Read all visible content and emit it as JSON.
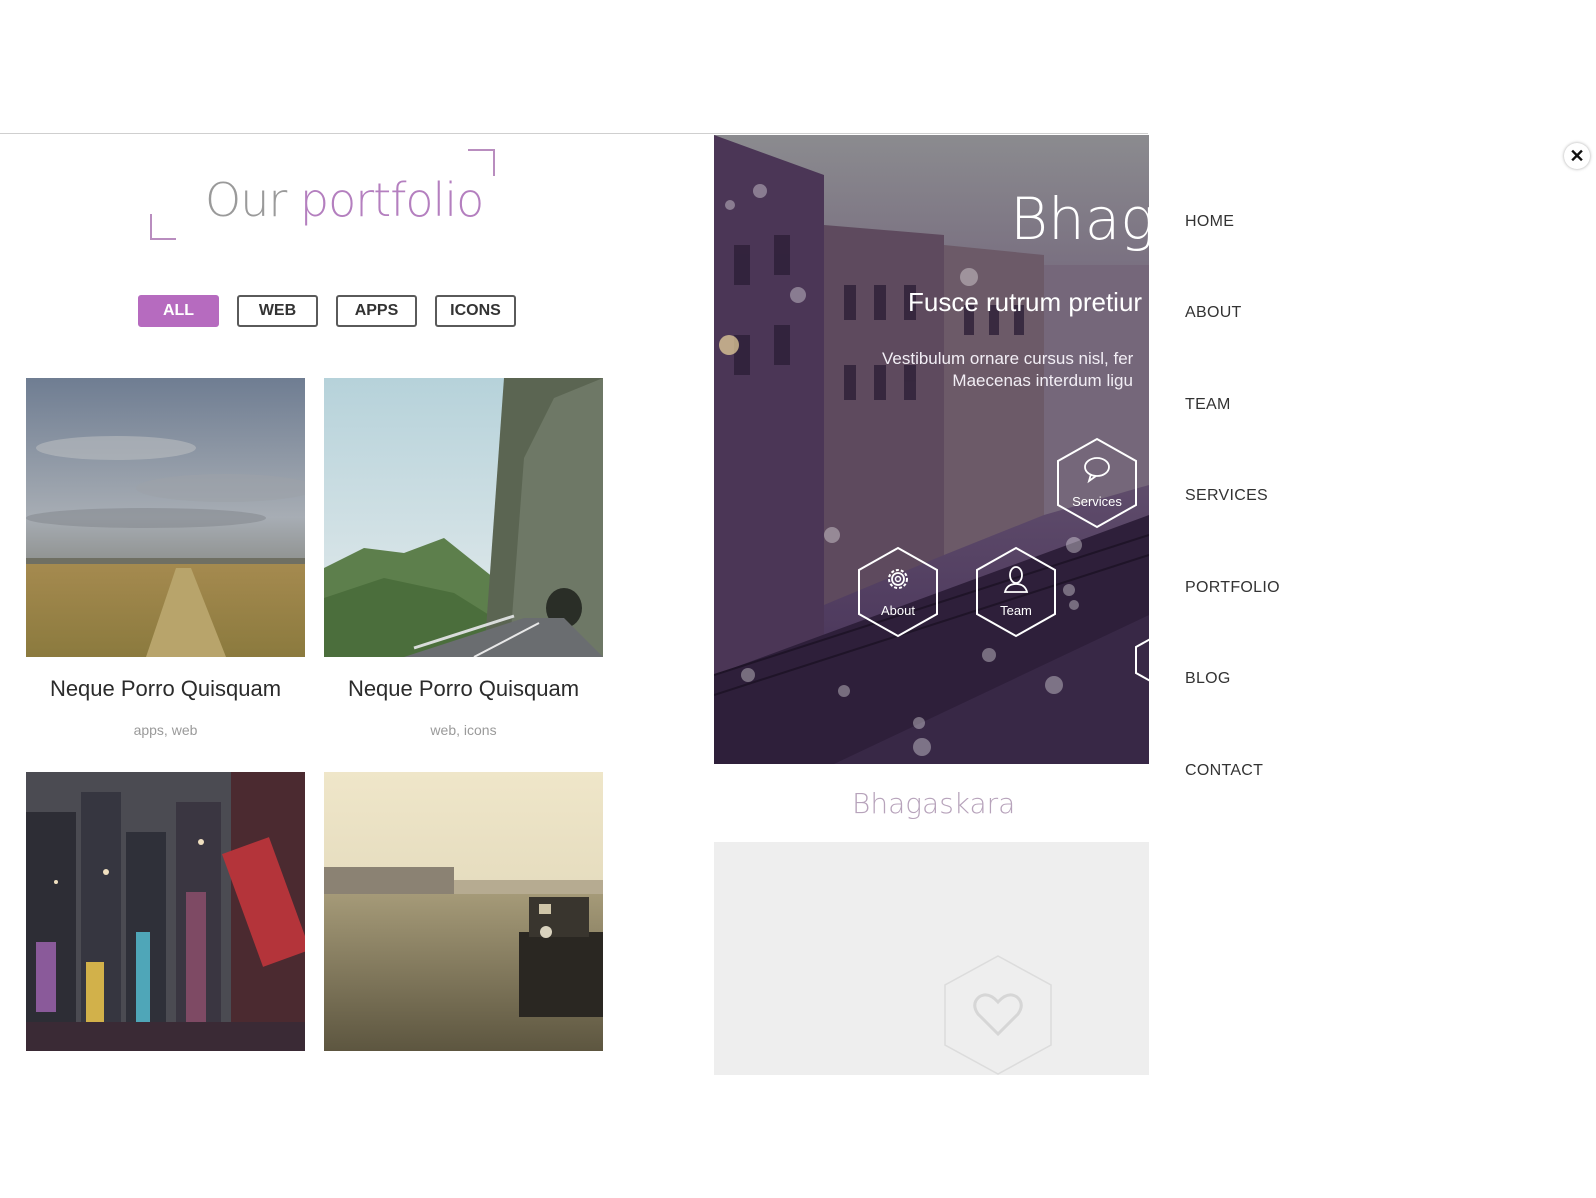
{
  "portfolio": {
    "title_plain": "Our ",
    "title_accent": "portfolio",
    "filters": [
      "ALL",
      "WEB",
      "APPS",
      "ICONS"
    ],
    "active_filter": "ALL",
    "items": [
      {
        "title": "Neque Porro Quisquam",
        "tags": "apps, web"
      },
      {
        "title": "Neque Porro Quisquam",
        "tags": "web, icons"
      },
      {
        "title": "",
        "tags": ""
      },
      {
        "title": "",
        "tags": ""
      }
    ]
  },
  "preview": {
    "hero_title": "Bhaga",
    "hero_subtitle": "Fusce rutrum pretiur",
    "hero_desc_line1": "Vestibulum ornare cursus nisl, fer",
    "hero_desc_line2": "Maecenas interdum ligu",
    "hexes": [
      {
        "label": "Services",
        "icon": "speech-bubble-icon"
      },
      {
        "label": "About",
        "icon": "gear-icon"
      },
      {
        "label": "Team",
        "icon": "person-icon"
      }
    ],
    "brand": "Bhagaskara",
    "panel_icon": "heart-icon"
  },
  "menu": {
    "items": [
      "HOME",
      "ABOUT",
      "TEAM",
      "SERVICES",
      "PORTFOLIO",
      "BLOG",
      "CONTACT"
    ],
    "close_icon": "close-icon"
  },
  "colors": {
    "accent": "#b66bbf",
    "phone_overlay": "#4a2f5e",
    "text_dark": "#333333"
  }
}
